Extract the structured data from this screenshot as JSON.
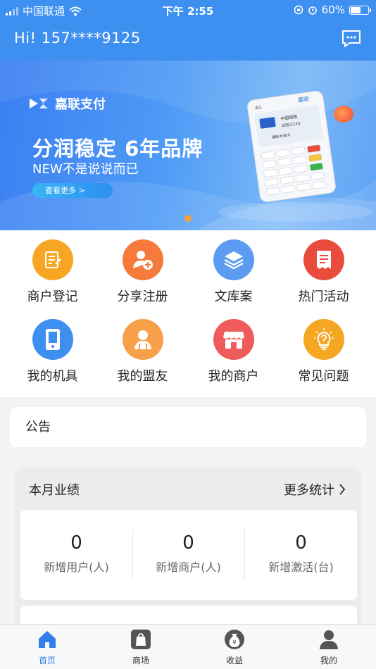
{
  "status": {
    "carrier": "中国联通",
    "time": "下午 2:55",
    "battery": "60%",
    "battery_level": 0.6
  },
  "header": {
    "greeting": "Hi! 157****9125",
    "message_icon": "chat-bubble-icon"
  },
  "banner": {
    "brand": "嘉联支付",
    "title": "分润稳定 6年品牌",
    "subtitle": "NEW不是说说而已",
    "button": "查看更多  >",
    "pos_screen_brand": "嘉联",
    "pos_screen_line1": "中国银联",
    "pos_screen_line2": "V991133",
    "pos_screen_line3": "请刷卡/插卡",
    "pos_top_label": "4G"
  },
  "grid": [
    {
      "label": "商户登记",
      "icon": "edit-note-icon",
      "color": "#f6a623"
    },
    {
      "label": "分享注册",
      "icon": "user-add-icon",
      "color": "#f57a3b"
    },
    {
      "label": "文库案",
      "icon": "layers-icon",
      "color": "#5b9cf2"
    },
    {
      "label": "热门活动",
      "icon": "receipt-icon",
      "color": "#e94c3d"
    },
    {
      "label": "我的机具",
      "icon": "phone-device-icon",
      "color": "#3d8ff0"
    },
    {
      "label": "我的盟友",
      "icon": "friend-icon",
      "color": "#f6a04a"
    },
    {
      "label": "我的商户",
      "icon": "shop-icon",
      "color": "#ef5a5a"
    },
    {
      "label": "常见问题",
      "icon": "bulb-question-icon",
      "color": "#f5a623"
    }
  ],
  "notice": {
    "label": "公告"
  },
  "performance": {
    "title": "本月业绩",
    "more": "更多统计",
    "stats": [
      {
        "value": "0",
        "caption": "新增用户(人)"
      },
      {
        "value": "0",
        "caption": "新增商户(人)"
      },
      {
        "value": "0",
        "caption": "新增激活(台)"
      }
    ]
  },
  "tabs": [
    {
      "label": "首页",
      "icon": "home-icon",
      "active": true
    },
    {
      "label": "商场",
      "icon": "shopping-bag-icon",
      "active": false
    },
    {
      "label": "收益",
      "icon": "money-bag-icon",
      "active": false
    },
    {
      "label": "我的",
      "icon": "person-icon",
      "active": false
    }
  ],
  "colors": {
    "primary": "#3d8ff0",
    "accent_dot": "#f4a33a"
  }
}
